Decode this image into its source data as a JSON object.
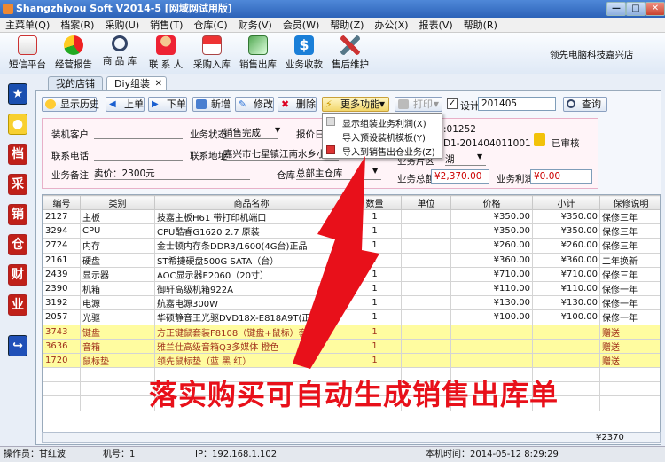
{
  "window": {
    "title": "Shangzhiyou Soft V2014-5 [网域网试用版]"
  },
  "menu": [
    "主菜单(Q)",
    "档案(R)",
    "采购(U)",
    "销售(T)",
    "仓库(C)",
    "财务(V)",
    "会员(W)",
    "帮助(Z)",
    "办公(X)",
    "报表(V)",
    "帮助(R)"
  ],
  "toolbar": [
    {
      "label": "短信平台",
      "icon": "envelope-icon"
    },
    {
      "label": "经营报告",
      "icon": "pie-chart-icon"
    },
    {
      "label": "商 品 库",
      "icon": "magnifier-icon"
    },
    {
      "label": "联 系 人",
      "icon": "person-icon"
    },
    {
      "label": "采购入库",
      "icon": "house-icon"
    },
    {
      "label": "销售出库",
      "icon": "certificate-icon"
    },
    {
      "label": "业务收款",
      "icon": "dollar-icon"
    },
    {
      "label": "售后维护",
      "icon": "tools-icon"
    }
  ],
  "company": "领先电脑科技嘉兴店",
  "sidebar": [
    "★",
    "●",
    "档",
    "采",
    "销",
    "仓",
    "财",
    "业",
    "↪"
  ],
  "tabs": [
    "我的店铺",
    "Diy组装"
  ],
  "actions": {
    "history": "显示历史",
    "prev": "上单",
    "next": "下单",
    "add": "新增",
    "edit": "修改",
    "delete": "删除",
    "more": "更多功能",
    "print": "打印",
    "design": "设计",
    "period": "201405",
    "query": "查询"
  },
  "more_menu": [
    "显示组装业务利润(X)",
    "导入预设装机模板(Y)",
    "导入到销售出仓业务(Z)"
  ],
  "form": {
    "customer_label": "装机客户",
    "customer_value": "",
    "status_label": "业务状态",
    "status_value": "销售完成",
    "report_date_label": "报价日期",
    "doc_no_tail": ":01252",
    "doc_no_full": "D1-201404011001",
    "phone_label": "联系电话",
    "address_label": "联系地址",
    "address_value": "嘉兴市七星镇江南水乡小区",
    "district_label": "业务片区",
    "district_value": "湖",
    "note_label": "业务备注",
    "note_value": "卖价：2300元",
    "warehouse_label": "仓库",
    "warehouse_value": "总部主仓库",
    "total_label": "业务总额",
    "total_value": "¥2,370.00",
    "profit_label": "业务利润",
    "profit_value": "¥0.00",
    "audit": "已审核"
  },
  "grid": {
    "headers": [
      "编号",
      "类别",
      "商品名称",
      "数量",
      "单位",
      "价格",
      "小计",
      "保修说明"
    ],
    "rows": [
      [
        "2127",
        "主板",
        "技嘉主板H61 带打印机端口",
        "1",
        "",
        "¥350.00",
        "¥350.00",
        "保修三年",
        false
      ],
      [
        "3294",
        "CPU",
        "CPU酷睿G1620 2.7 原装",
        "1",
        "",
        "¥350.00",
        "¥350.00",
        "保修三年",
        false
      ],
      [
        "2724",
        "内存",
        "金士顿内存条DDR3/1600(4G台)正品",
        "1",
        "",
        "¥260.00",
        "¥260.00",
        "保修三年",
        false
      ],
      [
        "2161",
        "硬盘",
        "ST希捷硬盘500G SATA（台）",
        "1",
        "",
        "¥360.00",
        "¥360.00",
        "二年换新",
        false
      ],
      [
        "2439",
        "显示器",
        "AOC显示器E2060（20寸）",
        "1",
        "",
        "¥710.00",
        "¥710.00",
        "保修三年",
        false
      ],
      [
        "2390",
        "机箱",
        "御轩高级机箱922A",
        "1",
        "",
        "¥110.00",
        "¥110.00",
        "保修一年",
        false
      ],
      [
        "3192",
        "电源",
        "航嘉电源300W",
        "1",
        "",
        "¥130.00",
        "¥130.00",
        "保修一年",
        false
      ],
      [
        "2057",
        "光驱",
        "华硕静音王光驱DVD18X-E818A9T(正品",
        "1",
        "",
        "¥100.00",
        "¥100.00",
        "保修一年",
        false
      ],
      [
        "3743",
        "键盘",
        "方正键鼠套装F8108（键盘+鼠标）套",
        "1",
        "",
        "",
        "",
        "赠送",
        true
      ],
      [
        "3636",
        "音箱",
        "雅兰仕高级音箱Q3多媒体 橙色",
        "1",
        "",
        "",
        "",
        "赠送",
        true
      ],
      [
        "1720",
        "鼠标垫",
        "领先鼠标垫（蓝 黑 红）",
        "1",
        "",
        "",
        "",
        "赠送",
        true
      ]
    ],
    "total": "¥2370"
  },
  "overlay_text": "落实购买可自动生成销售出库单",
  "statusbar": {
    "operator": "操作员：甘红波",
    "machine": "机号：1",
    "ip": "IP：192.168.1.102",
    "time": "本机时间：2014-05-12 8:29:29"
  },
  "colors": {
    "accent_red": "#e8101a",
    "gift_row": "#fffca0",
    "titlebar": "#2c62b8"
  }
}
